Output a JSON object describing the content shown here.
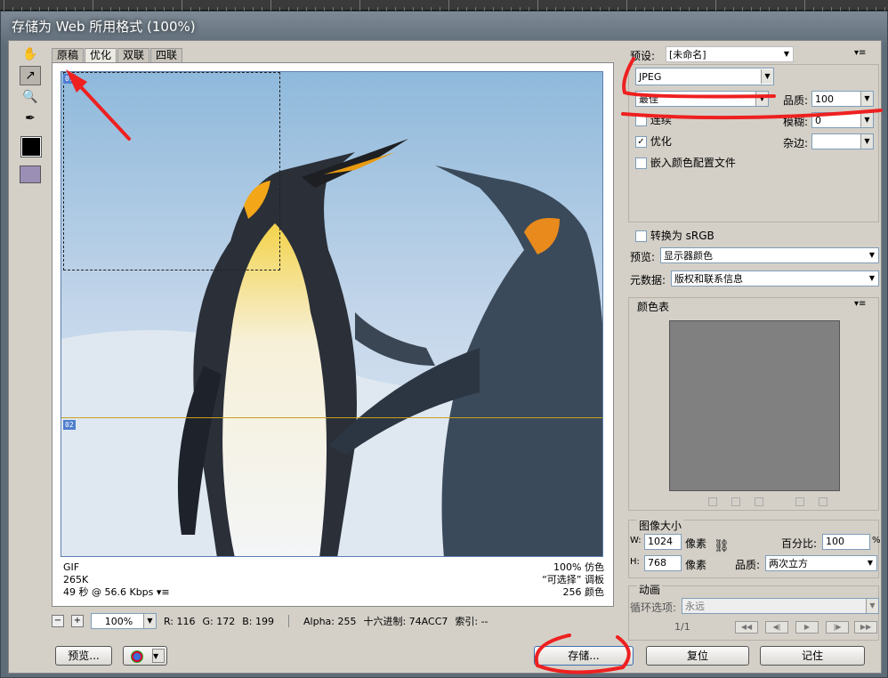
{
  "dialog": {
    "title": "存储为 Web 所用格式 (100%)"
  },
  "tabs": [
    "原稿",
    "优化",
    "双联",
    "四联"
  ],
  "slices": {
    "a": "01",
    "b": "02"
  },
  "image_info": {
    "format": "GIF",
    "size": "265K",
    "time": "49 秒 @ 56.6 Kbps",
    "dither": "100% 仿色",
    "palette": "“可选择” 调板",
    "colors": "256 颜色"
  },
  "status": {
    "zoom": "100%",
    "r": "R: 116",
    "g": "G: 172",
    "b": "B: 199",
    "alpha": "Alpha: 255",
    "hex": "十六进制: 74ACC7",
    "index": "索引: --"
  },
  "buttons": {
    "preview": "预览...",
    "save": "存储...",
    "reset": "复位",
    "remember": "记住"
  },
  "settings": {
    "preset_label": "预设:",
    "preset_value": "[未命名]",
    "format": "JPEG",
    "quality_preset": "最佳",
    "quality_label": "品质:",
    "quality_value": "100",
    "progressive": "连续",
    "blur_label": "模糊:",
    "blur_value": "0",
    "optimized": "优化",
    "matte_label": "杂边:",
    "embed_profile": "嵌入颜色配置文件",
    "convert_srgb": "转换为 sRGB",
    "preview_label": "预览:",
    "preview_value": "显示器颜色",
    "metadata_label": "元数据:",
    "metadata_value": "版权和联系信息"
  },
  "color_table": {
    "title": "颜色表"
  },
  "image_size": {
    "title": "图像大小",
    "w_label": "W:",
    "w_value": "1024",
    "h_label": "H:",
    "h_value": "768",
    "unit": "像素",
    "percent_label": "百分比:",
    "percent_value": "100",
    "percent_unit": "%",
    "quality_label": "品质:",
    "quality_value": "两次立方"
  },
  "animation": {
    "title": "动画",
    "loop_label": "循环选项:",
    "loop_value": "永远",
    "frame": "1/1"
  }
}
